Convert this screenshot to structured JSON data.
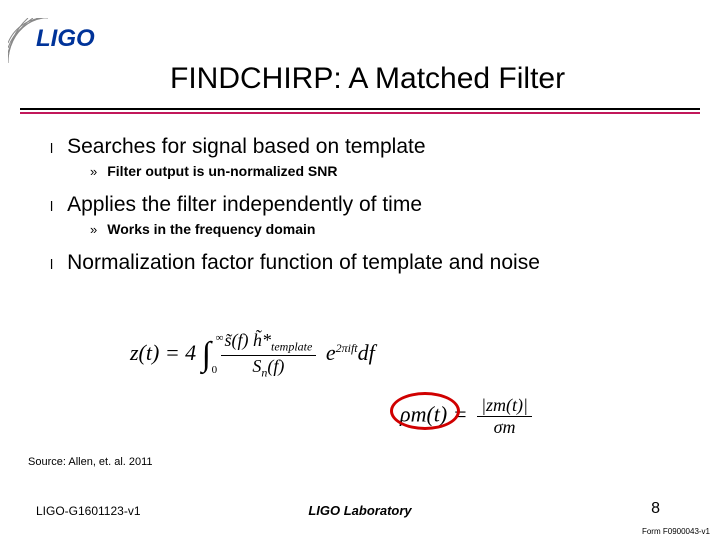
{
  "logo_text": "LIGO",
  "title": "FINDCHIRP: A Matched Filter",
  "bullets": [
    {
      "text": "Searches for signal based on template",
      "sub": "Filter output is un-normalized SNR"
    },
    {
      "text": "Applies the filter independently of time",
      "sub": "Works in the frequency domain"
    },
    {
      "text": "Normalization factor function of template and noise",
      "sub": null
    }
  ],
  "equations": {
    "eq1_lhs": "z(t) = 4",
    "eq1_int_lower": "0",
    "eq1_int_upper": "∞",
    "eq1_num": "s̃(f) h̃*",
    "eq1_num_sub": "template",
    "eq1_den": "S",
    "eq1_den_sub": "n",
    "eq1_den_arg": "(f)",
    "eq1_exp": "e",
    "eq1_exp_sup": "2πift",
    "eq1_tail": "df",
    "eq2_lhs": "ρ",
    "eq2_lhs_sub": "m",
    "eq2_lhs_arg": "(t) =",
    "eq2_num_lhs": "|z",
    "eq2_num_sub": "m",
    "eq2_num_tail": "(t)|",
    "eq2_den": "σ",
    "eq2_den_sub": "m"
  },
  "source": "Source: Allen, et. al. 2011",
  "doc_id": "LIGO-G1601123-v1",
  "lab": "LIGO Laboratory",
  "page": "8",
  "form": "Form F0900043-v1"
}
